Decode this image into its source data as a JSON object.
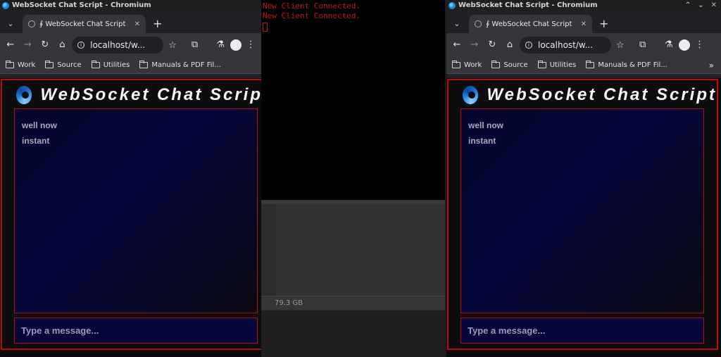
{
  "terminal": {
    "partial_line": "...................",
    "lines": [
      "New Client Connected.",
      "New Client Connected."
    ]
  },
  "file_manager": {
    "free_space": "79.3 GB"
  },
  "windows": [
    {
      "title": "WebSocket Chat Script - Chromium",
      "controls": [
        "⌃",
        "⌄",
        "✕"
      ],
      "tab_title": "∮ WebSocket Chat Script",
      "url": "localhost/w...",
      "bookmarks": [
        "Work",
        "Source",
        "Utilities",
        "Manuals & PDF Fil..."
      ],
      "bookmarks_more": "»",
      "chat_title": "WebSocket Chat Script",
      "messages": [
        "well now",
        "instant"
      ],
      "input_placeholder": "Type a message..."
    },
    {
      "title": "WebSocket Chat Script - Chromium",
      "controls": [
        "⌃",
        "⌄",
        "✕"
      ],
      "tab_title": "∮ WebSocket Chat Script",
      "url": "localhost/w...",
      "bookmarks": [
        "Work",
        "Source",
        "Utilities",
        "Manuals & PDF Fil..."
      ],
      "bookmarks_more": "»",
      "chat_title": "WebSocket Chat Script",
      "messages": [
        "well now",
        "instant"
      ],
      "input_placeholder": "Type a message..."
    }
  ],
  "colors": {
    "accent_red": "#b80d0d",
    "terminal_text": "#c11a1a",
    "chat_bg": "#05052e"
  },
  "icons": {
    "back": "back-arrow-icon",
    "forward": "forward-arrow-icon",
    "reload": "reload-icon",
    "home": "home-icon",
    "extensions": "puzzle-icon",
    "labs": "flask-icon",
    "menu": "kebab-menu-icon"
  }
}
